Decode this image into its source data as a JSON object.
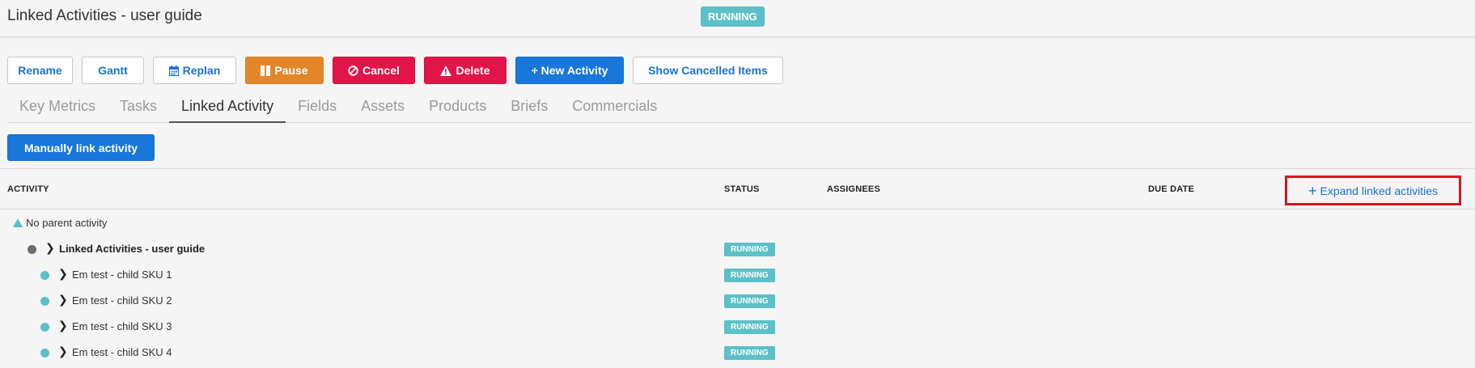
{
  "header": {
    "title": "Linked Activities - user guide",
    "status": "RUNNING",
    "status_color": "#5bc0c8"
  },
  "toolbar": {
    "rename": "Rename",
    "gantt": "Gantt",
    "replan": "Replan",
    "pause": "Pause",
    "cancel": "Cancel",
    "delete": "Delete",
    "new_activity": "+ New Activity",
    "show_cancelled": "Show Cancelled Items"
  },
  "tabs": [
    {
      "label": "Key Metrics",
      "active": false
    },
    {
      "label": "Tasks",
      "active": false
    },
    {
      "label": "Linked Activity",
      "active": true
    },
    {
      "label": "Fields",
      "active": false
    },
    {
      "label": "Assets",
      "active": false
    },
    {
      "label": "Products",
      "active": false
    },
    {
      "label": "Briefs",
      "active": false
    },
    {
      "label": "Commercials",
      "active": false
    }
  ],
  "link_button": "Manually link activity",
  "table": {
    "columns": {
      "activity": "ACTIVITY",
      "status": "STATUS",
      "assignees": "ASSIGNEES",
      "due_date": "DUE DATE"
    },
    "expand_label": "Expand linked activities",
    "parent_label": "No parent activity",
    "rows": [
      {
        "label": "Linked Activities - user guide",
        "status": "RUNNING",
        "dot_color": "#6b6b6b",
        "bold": true
      },
      {
        "label": "Em test - child SKU 1",
        "status": "RUNNING",
        "dot_color": "#5bc0c8",
        "bold": false
      },
      {
        "label": "Em test - child SKU 2",
        "status": "RUNNING",
        "dot_color": "#5bc0c8",
        "bold": false
      },
      {
        "label": "Em test - child SKU 3",
        "status": "RUNNING",
        "dot_color": "#5bc0c8",
        "bold": false
      },
      {
        "label": "Em test - child SKU 4",
        "status": "RUNNING",
        "dot_color": "#5bc0c8",
        "bold": false
      }
    ]
  },
  "colors": {
    "accent_blue": "#1877d9",
    "pause_orange": "#e3862a",
    "danger_red": "#e2154a",
    "highlight_red": "#d9161c"
  },
  "icons": {
    "replan": "calendar-icon",
    "pause": "pause-icon",
    "cancel": "ban-icon",
    "delete": "warning-icon",
    "expand": "plus-icon",
    "parent": "triangle-up-icon",
    "row_toggle": "chevron-right-icon"
  }
}
